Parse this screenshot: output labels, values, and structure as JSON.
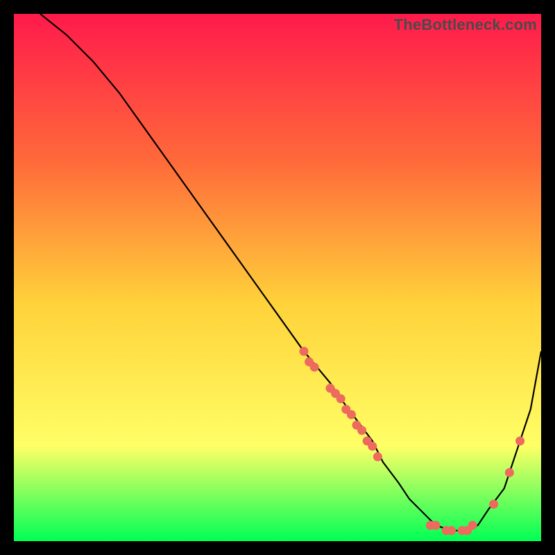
{
  "watermark": "TheBottleneck.com",
  "colors": {
    "gradient_top": "#ff1a4b",
    "gradient_mid_upper": "#ff6a3a",
    "gradient_mid": "#ffd23a",
    "gradient_lower": "#ffff66",
    "gradient_bottom": "#00ff55",
    "curve": "#000000",
    "dot": "#ec6a5e",
    "frame_bg": "#000000"
  },
  "chart_data": {
    "type": "line",
    "title": "",
    "xlabel": "",
    "ylabel": "",
    "xlim": [
      0,
      100
    ],
    "ylim": [
      0,
      100
    ],
    "x": [
      5,
      10,
      15,
      20,
      25,
      30,
      35,
      40,
      45,
      50,
      55,
      60,
      62,
      65,
      68,
      70,
      73,
      75,
      78,
      80,
      83,
      85,
      88,
      90,
      93,
      95,
      98,
      100
    ],
    "values": [
      100,
      96,
      91,
      85,
      78,
      71,
      64,
      57,
      50,
      43,
      36,
      30,
      27,
      23,
      19,
      15,
      11,
      8,
      5,
      3,
      2,
      2,
      3,
      6,
      10,
      16,
      25,
      36
    ],
    "series": [
      {
        "name": "scatter-dots",
        "type": "scatter",
        "points": [
          {
            "x": 55,
            "y": 36
          },
          {
            "x": 56,
            "y": 34
          },
          {
            "x": 57,
            "y": 33
          },
          {
            "x": 60,
            "y": 29
          },
          {
            "x": 61,
            "y": 28
          },
          {
            "x": 62,
            "y": 27
          },
          {
            "x": 63,
            "y": 25
          },
          {
            "x": 64,
            "y": 24
          },
          {
            "x": 65,
            "y": 22
          },
          {
            "x": 66,
            "y": 21
          },
          {
            "x": 67,
            "y": 19
          },
          {
            "x": 68,
            "y": 18
          },
          {
            "x": 69,
            "y": 16
          },
          {
            "x": 79,
            "y": 3
          },
          {
            "x": 80,
            "y": 3
          },
          {
            "x": 82,
            "y": 2
          },
          {
            "x": 83,
            "y": 2
          },
          {
            "x": 85,
            "y": 2
          },
          {
            "x": 86,
            "y": 2
          },
          {
            "x": 87,
            "y": 3
          },
          {
            "x": 91,
            "y": 7
          },
          {
            "x": 94,
            "y": 13
          },
          {
            "x": 96,
            "y": 19
          }
        ]
      }
    ]
  }
}
